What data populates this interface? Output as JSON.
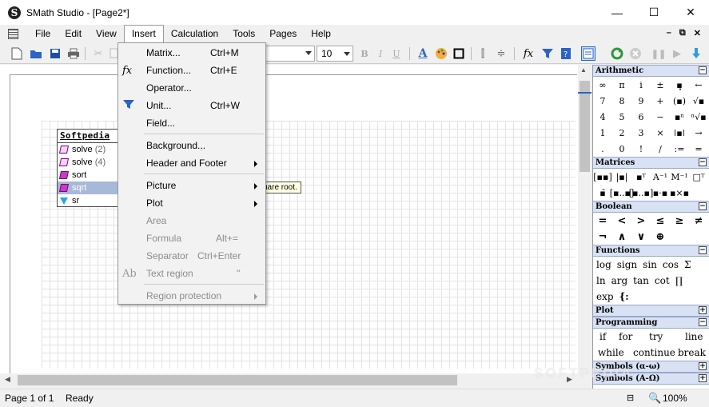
{
  "window": {
    "title": "SMath Studio - [Page2*]",
    "app_icon": "S",
    "minimize": "—",
    "maximize": "☐",
    "close": "✕"
  },
  "menubar": {
    "items": [
      "File",
      "Edit",
      "View",
      "Insert",
      "Calculation",
      "Tools",
      "Pages",
      "Help"
    ],
    "mdi": {
      "minimize": "–",
      "restore": "⧉",
      "close": "✕"
    }
  },
  "toolbar": {
    "font_size": "10"
  },
  "insert_menu": {
    "items": [
      {
        "label": "Matrix...",
        "shortcut": "Ctrl+M"
      },
      {
        "label": "Function...",
        "shortcut": "Ctrl+E"
      },
      {
        "label": "Operator...",
        "shortcut": ""
      },
      {
        "label": "Unit...",
        "shortcut": "Ctrl+W"
      },
      {
        "label": "Field...",
        "shortcut": ""
      },
      {
        "label": "Background...",
        "shortcut": ""
      },
      {
        "label": "Header and Footer",
        "shortcut": ""
      },
      {
        "label": "Picture",
        "shortcut": ""
      },
      {
        "label": "Plot",
        "shortcut": ""
      },
      {
        "label": "Area",
        "shortcut": ""
      },
      {
        "label": "Formula",
        "shortcut": "Alt+="
      },
      {
        "label": "Separator",
        "shortcut": "Ctrl+Enter"
      },
      {
        "label": "Text region",
        "shortcut": "\""
      },
      {
        "label": "Region protection",
        "shortcut": ""
      }
    ],
    "icons": {
      "function": "fx",
      "text_region": "Ab"
    }
  },
  "autocomplete": {
    "header": "Softpedia",
    "items": [
      {
        "name": "solve",
        "count": "(2)"
      },
      {
        "name": "solve",
        "count": "(4)"
      },
      {
        "name": "sort",
        "count": ""
      },
      {
        "name": "sqrt",
        "count": ""
      },
      {
        "name": "sr",
        "count": ""
      }
    ],
    "tooltip": "uare root."
  },
  "panel": {
    "arithmetic": {
      "title": "Arithmetic",
      "toggle": "−",
      "symbols": [
        "∞",
        "π",
        "i",
        "±",
        "▪̥",
        "←",
        "7",
        "8",
        "9",
        "+",
        "(▪)",
        "√▪",
        "4",
        "5",
        "6",
        "−",
        "▪ⁿ",
        "ⁿ√▪",
        "1",
        "2",
        "3",
        "×",
        "ǀ▪ǀ",
        "→",
        ".",
        "0",
        "!",
        "/",
        ":=",
        "="
      ]
    },
    "matrices": {
      "title": "Matrices",
      "toggle": "−",
      "symbols": [
        "[▪▪]",
        "|▪|",
        "▪ᵀ",
        "A⁻¹",
        "M⁻¹",
        "□ᵀ",
        "▪̄",
        "[▪..▪]",
        "[▪..▪]",
        "▪·▪",
        "▪×▪",
        ""
      ]
    },
    "boolean": {
      "title": "Boolean",
      "toggle": "−",
      "symbols": [
        "=",
        "<",
        ">",
        "≤",
        "≥",
        "≠",
        "¬",
        "∧",
        "∨",
        "⊕",
        "",
        ""
      ]
    },
    "functions": {
      "title": "Functions",
      "toggle": "−",
      "row1": [
        "log",
        "sign",
        "sin",
        "cos",
        "Σ"
      ],
      "row2": [
        "ln",
        "arg",
        "tan",
        "cot",
        "∏"
      ],
      "row3": [
        "exp",
        "{:"
      ]
    },
    "plot": {
      "title": "Plot",
      "toggle": "+"
    },
    "programming": {
      "title": "Programming",
      "toggle": "−",
      "row1": [
        "if",
        "for",
        "try",
        "line"
      ],
      "row2": [
        "while",
        "continue",
        "break"
      ]
    },
    "symbols_lower": {
      "title": "Symbols (α-ω)",
      "toggle": "+"
    },
    "symbols_upper": {
      "title": "Symbols (Α-Ω)",
      "toggle": "+"
    }
  },
  "status": {
    "page": "Page 1 of 1",
    "state": "Ready",
    "zoom": "100%",
    "split_icon": "⊟",
    "zoom_icon": "🔍"
  },
  "watermark": "SOFTPEDIA"
}
